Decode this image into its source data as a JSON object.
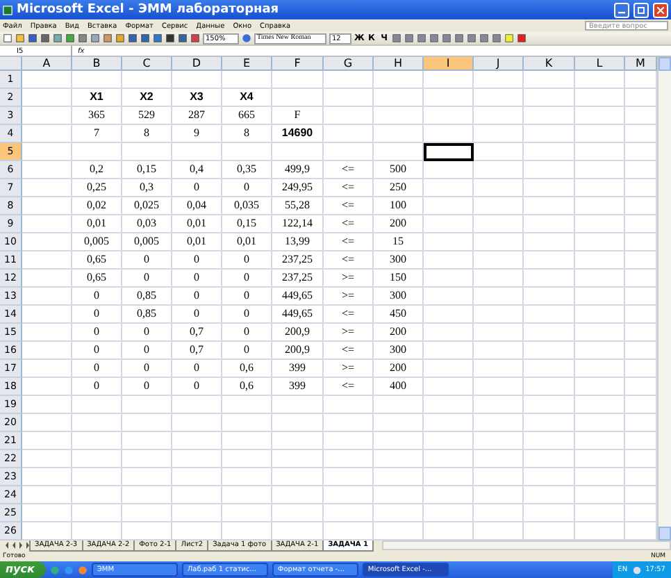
{
  "window": {
    "title": "Microsoft Excel - ЭММ лабораторная"
  },
  "menu": [
    "Файл",
    "Правка",
    "Вид",
    "Вставка",
    "Формат",
    "Сервис",
    "Данные",
    "Окно",
    "Справка"
  ],
  "help_search": {
    "placeholder": "Введите вопрос"
  },
  "toolbar": {
    "zoom": "150%",
    "font": "Times New Roman",
    "size": "12",
    "format_buttons": [
      "Ж",
      "К",
      "Ч"
    ]
  },
  "formula_bar": {
    "name_box": "I5",
    "fx": "fx"
  },
  "columns": [
    {
      "label": "A",
      "selected": false
    },
    {
      "label": "B",
      "selected": false
    },
    {
      "label": "C",
      "selected": false
    },
    {
      "label": "D",
      "selected": false
    },
    {
      "label": "E",
      "selected": false
    },
    {
      "label": "F",
      "selected": false
    },
    {
      "label": "G",
      "selected": false
    },
    {
      "label": "H",
      "selected": false
    },
    {
      "label": "I",
      "selected": true
    },
    {
      "label": "J",
      "selected": false
    },
    {
      "label": "K",
      "selected": false
    },
    {
      "label": "L",
      "selected": false
    },
    {
      "label": "M",
      "selected": false
    }
  ],
  "rows": [
    {
      "header": "1",
      "selected": false,
      "cells": []
    },
    {
      "header": "2",
      "selected": false,
      "cells": [
        null,
        {
          "text": "X1",
          "bold": true
        },
        {
          "text": "X2",
          "bold": true
        },
        {
          "text": "X3",
          "bold": true
        },
        {
          "text": "X4",
          "bold": true
        }
      ]
    },
    {
      "header": "3",
      "selected": false,
      "cells": [
        null,
        "365",
        "529",
        "287",
        "665",
        "F"
      ]
    },
    {
      "header": "4",
      "selected": false,
      "cells": [
        null,
        "7",
        "8",
        "9",
        "8",
        {
          "text": "14690",
          "bold": true
        }
      ]
    },
    {
      "header": "5",
      "selected": true,
      "cells": []
    },
    {
      "header": "6",
      "selected": false,
      "cells": [
        null,
        "0,2",
        "0,15",
        "0,4",
        "0,35",
        "499,9",
        "<=",
        "500"
      ]
    },
    {
      "header": "7",
      "selected": false,
      "cells": [
        null,
        "0,25",
        "0,3",
        "0",
        "0",
        "249,95",
        "<=",
        "250"
      ]
    },
    {
      "header": "8",
      "selected": false,
      "cells": [
        null,
        "0,02",
        "0,025",
        "0,04",
        "0,035",
        "55,28",
        "<=",
        "100"
      ]
    },
    {
      "header": "9",
      "selected": false,
      "cells": [
        null,
        "0,01",
        "0,03",
        "0,01",
        "0,15",
        "122,14",
        "<=",
        "200"
      ]
    },
    {
      "header": "10",
      "selected": false,
      "cells": [
        null,
        "0,005",
        "0,005",
        "0,01",
        "0,01",
        "13,99",
        "<=",
        "15"
      ]
    },
    {
      "header": "11",
      "selected": false,
      "cells": [
        null,
        "0,65",
        "0",
        "0",
        "0",
        "237,25",
        "<=",
        "300"
      ]
    },
    {
      "header": "12",
      "selected": false,
      "cells": [
        null,
        "0,65",
        "0",
        "0",
        "0",
        "237,25",
        ">=",
        "150"
      ]
    },
    {
      "header": "13",
      "selected": false,
      "cells": [
        null,
        "0",
        "0,85",
        "0",
        "0",
        "449,65",
        ">=",
        "300"
      ]
    },
    {
      "header": "14",
      "selected": false,
      "cells": [
        null,
        "0",
        "0,85",
        "0",
        "0",
        "449,65",
        "<=",
        "450"
      ]
    },
    {
      "header": "15",
      "selected": false,
      "cells": [
        null,
        "0",
        "0",
        "0,7",
        "0",
        "200,9",
        ">=",
        "200"
      ]
    },
    {
      "header": "16",
      "selected": false,
      "cells": [
        null,
        "0",
        "0",
        "0,7",
        "0",
        "200,9",
        "<=",
        "300"
      ]
    },
    {
      "header": "17",
      "selected": false,
      "cells": [
        null,
        "0",
        "0",
        "0",
        "0,6",
        "399",
        ">=",
        "200"
      ]
    },
    {
      "header": "18",
      "selected": false,
      "cells": [
        null,
        "0",
        "0",
        "0",
        "0,6",
        "399",
        "<=",
        "400"
      ]
    },
    {
      "header": "19",
      "selected": false,
      "cells": []
    },
    {
      "header": "20",
      "selected": false,
      "cells": []
    },
    {
      "header": "21",
      "selected": false,
      "cells": []
    },
    {
      "header": "22",
      "selected": false,
      "cells": []
    },
    {
      "header": "23",
      "selected": false,
      "cells": []
    },
    {
      "header": "24",
      "selected": false,
      "cells": []
    },
    {
      "header": "25",
      "selected": false,
      "cells": []
    },
    {
      "header": "26",
      "selected": false,
      "cells": []
    }
  ],
  "sheet_tabs": [
    {
      "label": "ЗАДАЧА 2-3",
      "selected": false
    },
    {
      "label": "ЗАДАЧА 2-2",
      "selected": false
    },
    {
      "label": "Фото 2-1",
      "selected": false
    },
    {
      "label": "Лист2",
      "selected": false
    },
    {
      "label": "Задача 1 фото",
      "selected": false
    },
    {
      "label": "ЗАДАЧА 2-1",
      "selected": false
    },
    {
      "label": "ЗАДАЧА 1",
      "selected": true
    }
  ],
  "status_bar": {
    "text": "Готово",
    "indicator": "NUM"
  },
  "taskbar": {
    "start": "пуск",
    "items": [
      {
        "label": "ЭММ",
        "selected": false
      },
      {
        "label": "Лаб.раб 1 статис...",
        "selected": false
      },
      {
        "label": "Формат отчета -...",
        "selected": false
      },
      {
        "label": "Microsoft Excel -...",
        "selected": true
      }
    ],
    "language": "EN",
    "clock": "17:57"
  }
}
